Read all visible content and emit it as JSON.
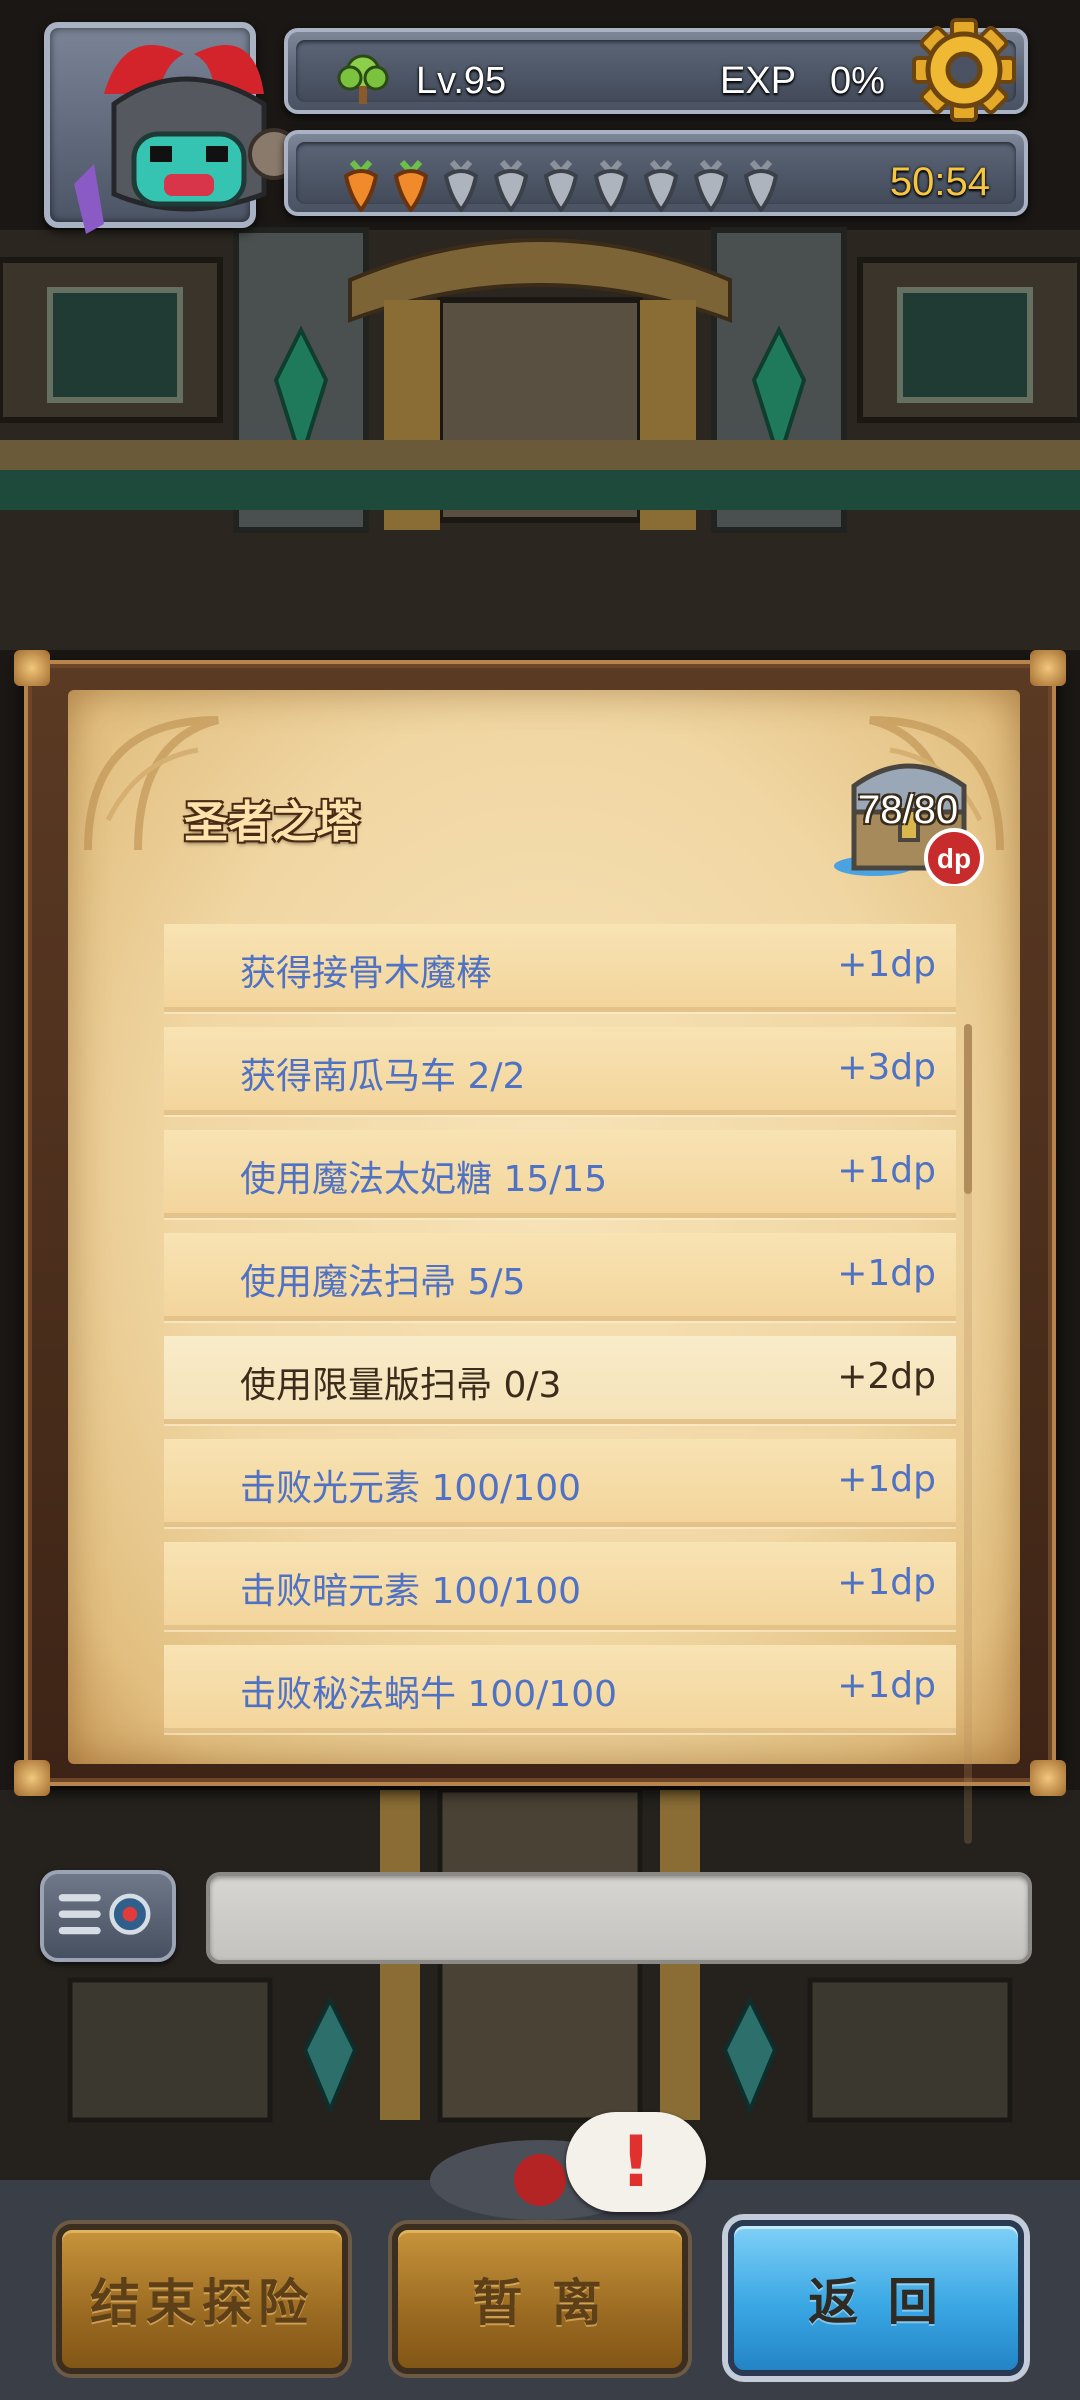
{
  "hud": {
    "level": "Lv.95",
    "exp_label": "EXP",
    "exp_value": "0%",
    "energy_total": 9,
    "energy_full": 2,
    "timer": "50:54"
  },
  "panel": {
    "title": "圣者之塔",
    "dp_progress": "78/80",
    "dp_badge": "dp",
    "tasks": [
      {
        "name": "获得接骨木魔棒",
        "reward": "+1dp",
        "completed": true
      },
      {
        "name": "获得南瓜马车 2/2",
        "reward": "+3dp",
        "completed": true
      },
      {
        "name": "使用魔法太妃糖 15/15",
        "reward": "+1dp",
        "completed": true
      },
      {
        "name": "使用魔法扫帚 5/5",
        "reward": "+1dp",
        "completed": true
      },
      {
        "name": "使用限量版扫帚 0/3",
        "reward": "+2dp",
        "completed": false
      },
      {
        "name": "击败光元素 100/100",
        "reward": "+1dp",
        "completed": true
      },
      {
        "name": "击败暗元素 100/100",
        "reward": "+1dp",
        "completed": true
      },
      {
        "name": "击败秘法蜗牛 100/100",
        "reward": "+1dp",
        "completed": true
      }
    ]
  },
  "chat": {
    "placeholder": ""
  },
  "alert": {
    "symbol": "!"
  },
  "buttons": {
    "end": "结束探险",
    "leave": "暂 离",
    "back": "返 回"
  },
  "colors": {
    "completed_task": "#4f72c4",
    "incomplete_task": "#3b2c1c",
    "timer": "#f6c640",
    "back_button": "#3aa7e3"
  },
  "icons": [
    "tree-icon",
    "gear-icon",
    "carrot-icon",
    "treasure-chest-icon",
    "dp-badge-icon",
    "chat-radio-icon",
    "alert-icon"
  ]
}
